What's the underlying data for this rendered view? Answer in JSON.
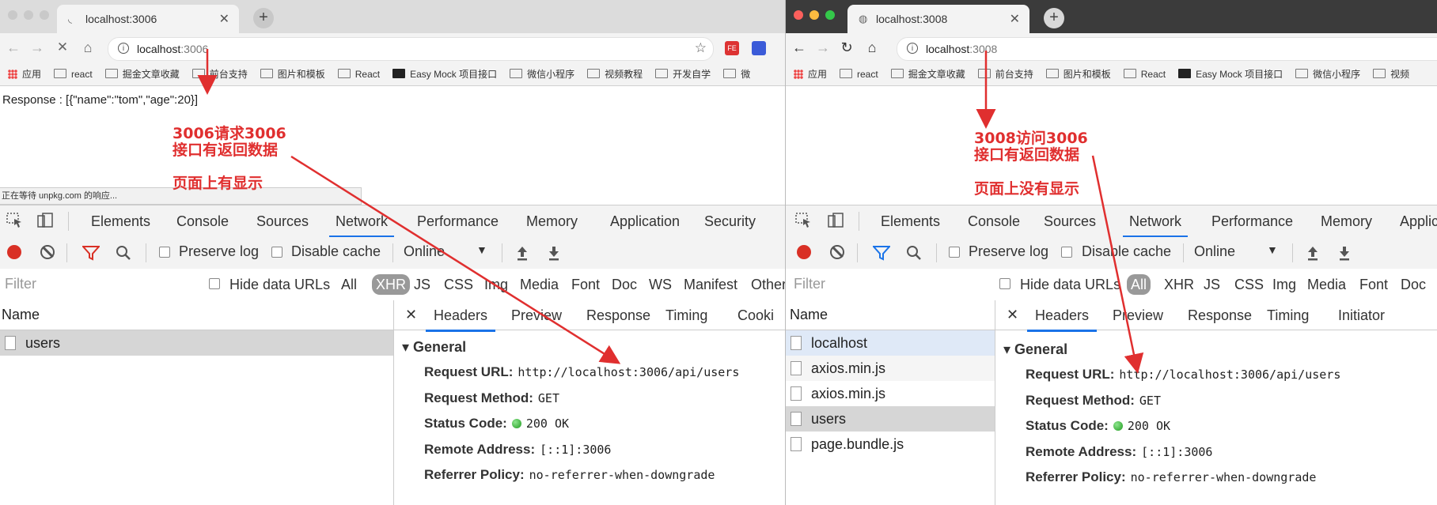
{
  "left": {
    "tab_title": "localhost:3006",
    "url_host": "localhost",
    "url_port": ":3006",
    "page_text": "Response : [{\"name\":\"tom\",\"age\":20}]",
    "status_text": "正在等待 unpkg.com 的响应...",
    "annotation_title": "3006请求3006\n接口有返回数据",
    "annotation_note": "页面上有显示",
    "files": [
      {
        "name": "users"
      }
    ]
  },
  "right": {
    "tab_title": "localhost:3008",
    "url_host": "localhost",
    "url_port": ":3008",
    "annotation_title": "3008访问3006\n接口有返回数据",
    "annotation_note": "页面上没有显示",
    "files": [
      {
        "name": "localhost"
      },
      {
        "name": "axios.min.js"
      },
      {
        "name": "axios.min.js"
      },
      {
        "name": "users"
      },
      {
        "name": "page.bundle.js"
      }
    ]
  },
  "bookmarks": [
    "应用",
    "react",
    "掘金文章收藏",
    "前台支持",
    "图片和模板",
    "React",
    "Easy Mock 项目接口",
    "微信小程序",
    "视频教程",
    "开发自学",
    "微"
  ],
  "bookmarks_right": [
    "应用",
    "react",
    "掘金文章收藏",
    "前台支持",
    "图片和模板",
    "React",
    "Easy Mock 项目接口",
    "微信小程序",
    "视频"
  ],
  "devtools": {
    "tabs_left": [
      "Elements",
      "Console",
      "Sources",
      "Network",
      "Performance",
      "Memory",
      "Application",
      "Security"
    ],
    "tabs_right": [
      "Elements",
      "Console",
      "Sources",
      "Network",
      "Performance",
      "Memory",
      "Applic"
    ],
    "preserve_log": "Preserve log",
    "disable_cache": "Disable cache",
    "throttle": "Online",
    "filter_placeholder": "Filter",
    "hide_data_urls": "Hide data URLs",
    "types_left": [
      "All",
      "XHR",
      "JS",
      "CSS",
      "Img",
      "Media",
      "Font",
      "Doc",
      "WS",
      "Manifest",
      "Other"
    ],
    "types_right": [
      "All",
      "XHR",
      "JS",
      "CSS",
      "Img",
      "Media",
      "Font",
      "Doc"
    ],
    "name_header": "Name",
    "detail_tabs_left": [
      "Headers",
      "Preview",
      "Response",
      "Timing",
      "Cooki"
    ],
    "detail_tabs_right": [
      "Headers",
      "Preview",
      "Response",
      "Timing",
      "Initiator"
    ],
    "general_label": "General",
    "headers": {
      "request_url_label": "Request URL:",
      "request_url": "http://localhost:3006/api/users",
      "method_label": "Request Method:",
      "method": "GET",
      "status_label": "Status Code:",
      "status": "200 OK",
      "remote_label": "Remote Address:",
      "remote": "[::1]:3006",
      "referrer_label": "Referrer Policy:",
      "referrer": "no-referrer-when-downgrade"
    }
  },
  "colors": {
    "accent": "#1a73e8",
    "annotation": "#e02f2f",
    "record": "#d93025"
  }
}
